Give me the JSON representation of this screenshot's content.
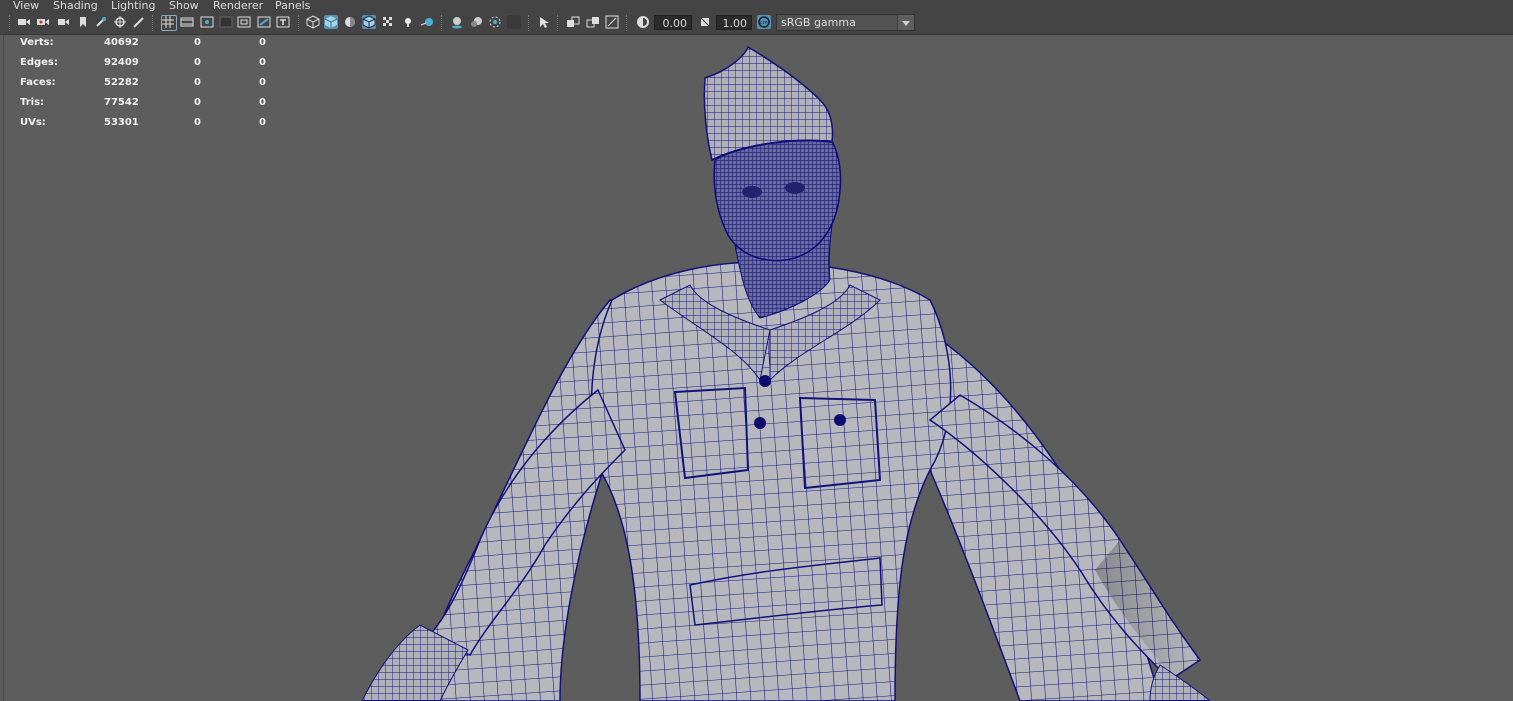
{
  "menu": [
    "View",
    "Shading",
    "Lighting",
    "Show",
    "Renderer",
    "Panels"
  ],
  "toolbar": {
    "exposure_value": "0.00",
    "gamma_value": "1.00",
    "colorspace_value": "sRGB gamma",
    "icons": [
      "select-camera-icon",
      "camera-attributes-icon",
      "bookmarks-icon",
      "image-plane-icon",
      "2d-pan-zoom-icon",
      "grease-pencil-icon",
      "grid-icon",
      "film-gate-icon",
      "resolution-gate-icon",
      "gate-mask-icon",
      "field-chart-icon",
      "safe-action-icon",
      "wireframe-icon",
      "smooth-shade-icon",
      "default-material-icon",
      "wireframe-on-shaded-icon",
      "textured-icon",
      "use-all-lights-icon",
      "shadows-icon",
      "screen-space-ao-icon",
      "motion-blur-icon",
      "multisample-aa-icon",
      "depth-of-field-icon",
      "isolate-select-icon",
      "xray-icon",
      "xray-active-icon",
      "xray-joints-icon",
      "exposure-icon",
      "gamma-icon",
      "color-management-icon"
    ]
  },
  "hud": {
    "rows": [
      {
        "label": "Verts:",
        "v0": "40692",
        "v1": "0",
        "v2": "0"
      },
      {
        "label": "Edges:",
        "v0": "92409",
        "v1": "0",
        "v2": "0"
      },
      {
        "label": "Faces:",
        "v0": "52282",
        "v1": "0",
        "v2": "0"
      },
      {
        "label": "Tris:",
        "v0": "77542",
        "v1": "0",
        "v2": "0"
      },
      {
        "label": "UVs:",
        "v0": "53301",
        "v1": "0",
        "v2": "0"
      }
    ]
  },
  "colors": {
    "viewport_bg": "#5d5d5d",
    "wireframe": "#0c0c7a",
    "mesh_shade": "#b9b9bd",
    "active_toggle": "#5a8fb1"
  }
}
